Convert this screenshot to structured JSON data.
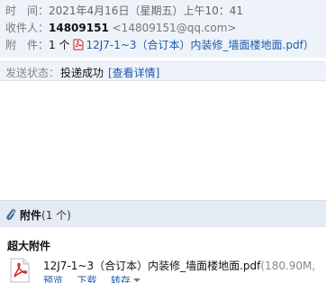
{
  "header": {
    "time_label": "时　间：",
    "time_value": "2021年4月16日（星期五）上午10：41",
    "recipient_label": "收件人：",
    "recipient_name": "14809151",
    "recipient_addr": "<14809151@qq.com>",
    "attachment_label": "附　件：",
    "attachment_count": "1 个",
    "attachment_link": "12J7-1~3（合订本）内装修_墙面楼地面.pdf）"
  },
  "status": {
    "label": "发送状态：",
    "value": "投递成功",
    "detail_link": "[查看详情]"
  },
  "attachments": {
    "title": "附件",
    "count": "(1 个)",
    "section_title": "超大附件",
    "file_name": "12J7-1~3（合订本）内装修_墙面楼地面.pdf",
    "file_size": "(180.90M,",
    "actions": {
      "preview": "预览",
      "download": "下载",
      "save": "转存"
    }
  },
  "icons": {
    "pdf": "pdf-file-icon",
    "clip": "paperclip-icon"
  }
}
